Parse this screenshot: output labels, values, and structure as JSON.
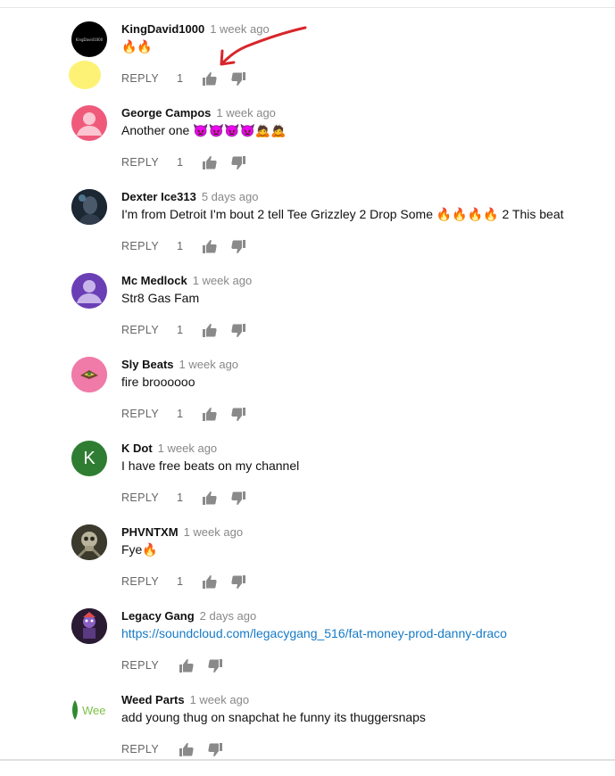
{
  "comments": [
    {
      "author": "KingDavid1000",
      "time": "1 week ago",
      "text": "🔥🔥",
      "reply": "REPLY",
      "likes": "1",
      "avatar": "dark-logo",
      "avatar_text": "KingDavid1000"
    },
    {
      "author": "George Campos",
      "time": "1 week ago",
      "text": "Another one 👿👿👿👿🙇🙇",
      "reply": "REPLY",
      "likes": "1",
      "avatar": "default-person-pink"
    },
    {
      "author": "Dexter Ice313",
      "time": "5 days ago",
      "text": "I'm from Detroit I'm bout 2 tell Tee Grizzley 2 Drop Some 🔥🔥🔥🔥 2 This beat",
      "reply": "REPLY",
      "likes": "1",
      "avatar": "dark-photo"
    },
    {
      "author": "Mc Medlock",
      "time": "1 week ago",
      "text": "Str8 Gas Fam",
      "reply": "REPLY",
      "likes": "1",
      "avatar": "default-person-purple"
    },
    {
      "author": "Sly Beats",
      "time": "1 week ago",
      "text": "fire broooooo",
      "reply": "REPLY",
      "likes": "1",
      "avatar": "pink-logo"
    },
    {
      "author": "K Dot",
      "time": "1 week ago",
      "text": "I have free beats on my channel",
      "reply": "REPLY",
      "likes": "1",
      "avatar": "letter-k-green",
      "avatar_letter": "K"
    },
    {
      "author": "PHVNTXM",
      "time": "1 week ago",
      "text": "Fye🔥",
      "reply": "REPLY",
      "likes": "1",
      "avatar": "skull-photo"
    },
    {
      "author": "Legacy Gang",
      "time": "2 days ago",
      "text": "https://soundcloud.com/legacygang_516/fat-money-prod-danny-draco",
      "reply": "REPLY",
      "likes": "",
      "avatar": "character-photo"
    },
    {
      "author": "Weed Parts",
      "time": "1 week ago",
      "text": "add young thug on snapchat he funny its thuggersnaps",
      "reply": "REPLY",
      "likes": "",
      "avatar": "leaf-logo",
      "avatar_text": "Wee"
    }
  ],
  "annotation": {
    "arrow_color": "#d7262b",
    "highlight_color": "#fdf276"
  },
  "colors": {
    "link": "#167ac6",
    "icon": "#8a8a8a",
    "meta": "#888888"
  }
}
